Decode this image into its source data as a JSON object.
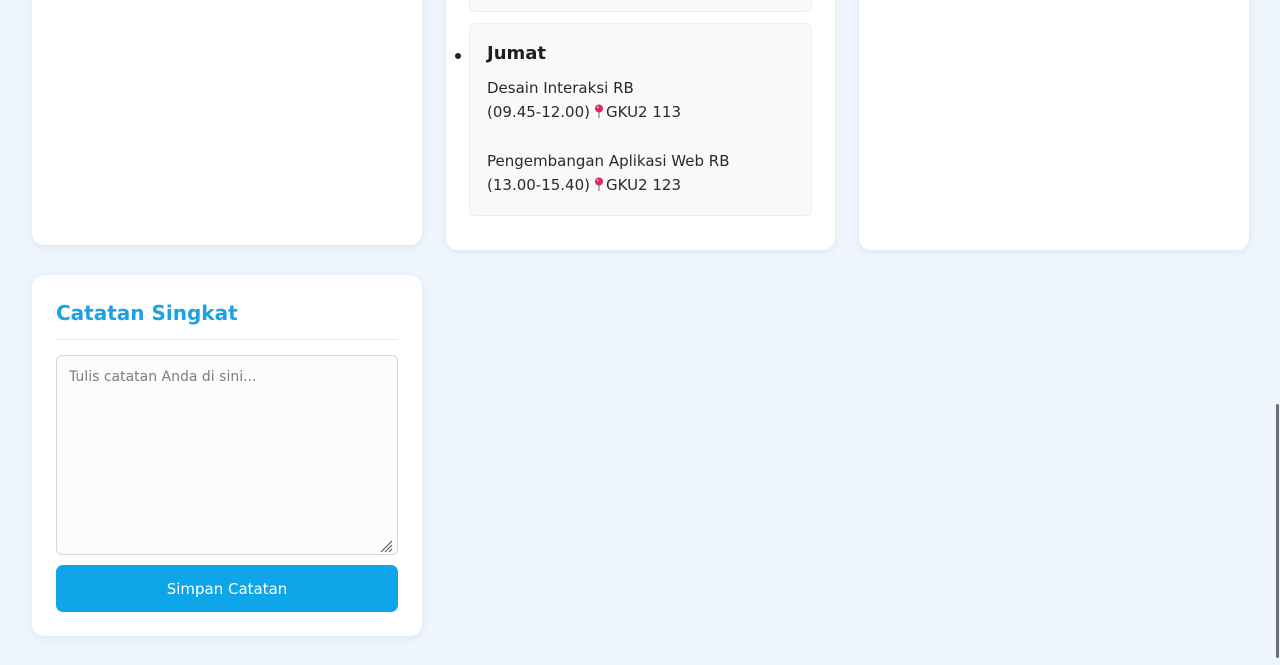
{
  "schedule": {
    "day": {
      "title": "Jumat",
      "courses": [
        {
          "name": "Desain Interaksi RB",
          "time": "(09.45-12.00)",
          "room": "GKU2 113"
        },
        {
          "name": "Pengembangan Aplikasi Web RB",
          "time": "(13.00-15.40)",
          "room": "GKU2 123"
        }
      ]
    }
  },
  "notes": {
    "title": "Catatan Singkat",
    "placeholder": "Tulis catatan Anda di sini...",
    "value": "",
    "save_label": "Simpan Catatan"
  },
  "icons": {
    "location": "round-pushpin-icon"
  },
  "colors": {
    "accent": "#0ea5e9",
    "title": "#1ea1e0",
    "background": "#eef5fd",
    "pin": "#e0245e"
  }
}
